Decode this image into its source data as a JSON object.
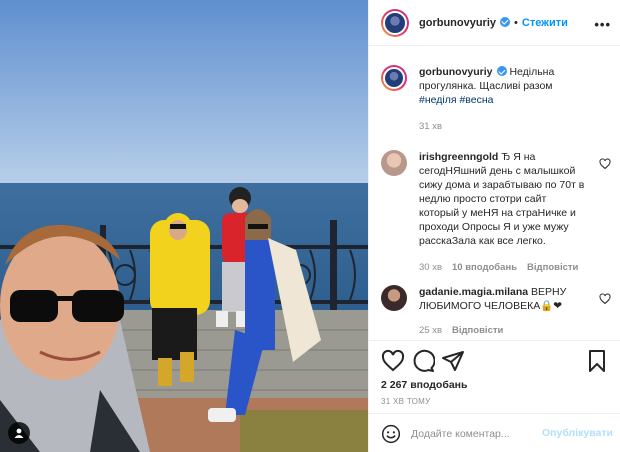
{
  "post": {
    "username": "gorbunovyuriy",
    "follow_label": "Стежити",
    "more_label": "•••",
    "caption_text": "Недільна прогулянка. Щасливі разом",
    "hashtag1": "#неділя",
    "hashtag2": "#весна",
    "caption_time": "31 хв"
  },
  "comments": [
    {
      "username": "irishgreenngold",
      "text": "Ђ Я на сегодНЯшний день с малышкой сижу дома и зарабтываю по 70т в недлю просто стотри сайт который у меНЯ на страНичке и проходи Опросы Я и уже мужу расскаЗала как все легко.",
      "time": "30 хв",
      "likes": "10 вподобань",
      "reply": "Відповісти"
    },
    {
      "username": "gadanie.magia.milana",
      "text": "ВЕРНУ ЛЮБИМОГО ЧЕЛОВЕКА🔒❤",
      "time": "25 хв",
      "reply": "Відповісти"
    }
  ],
  "stats": {
    "likes": "2 267 вподобань",
    "posted": "31 ХВ ТОМУ"
  },
  "add_comment": {
    "placeholder": "Додайте коментар...",
    "post_label": "Опублікувати"
  },
  "icons": {
    "like": "heart-icon",
    "comment": "comment-icon",
    "share": "share-icon",
    "save": "bookmark-icon",
    "emoji": "emoji-icon",
    "tagged": "user-tag-icon"
  },
  "colors": {
    "link": "#0095f6",
    "hashtag": "#00376b",
    "muted": "#8e8e8e",
    "post_disabled": "#b2dffc"
  }
}
